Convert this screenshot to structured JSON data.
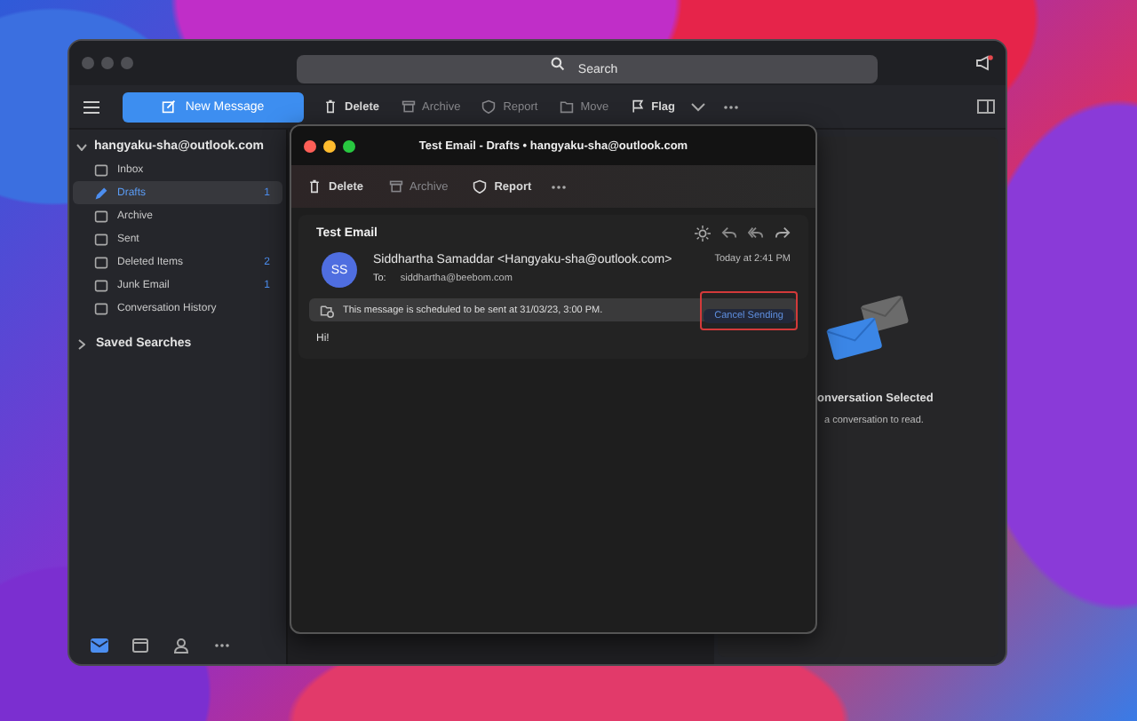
{
  "search": {
    "placeholder": "Search"
  },
  "toolbar": {
    "new_message": "New Message",
    "items": [
      {
        "label": "Delete",
        "disabled": false
      },
      {
        "label": "Archive",
        "disabled": true
      },
      {
        "label": "Report",
        "disabled": true
      },
      {
        "label": "Move",
        "disabled": true
      },
      {
        "label": "Flag",
        "disabled": false
      }
    ]
  },
  "sidebar": {
    "account": "hangyaku-sha@outlook.com",
    "expanded": true,
    "folders": [
      {
        "label": "Inbox",
        "selected": false
      },
      {
        "label": "Drafts",
        "count": "1",
        "selected": true
      },
      {
        "label": "Archive",
        "selected": false
      },
      {
        "label": "Sent",
        "selected": false
      },
      {
        "label": "Deleted Items",
        "count": "2",
        "selected": false
      },
      {
        "label": "Junk Email",
        "count": "1",
        "selected": false
      },
      {
        "label": "Conversation History",
        "selected": false
      }
    ],
    "saved_searches": {
      "label": "Saved Searches",
      "expanded": false
    },
    "nav": [
      {
        "selected": true
      },
      {
        "selected": false
      },
      {
        "selected": false
      },
      {
        "selected": false
      }
    ]
  },
  "reading_pane": {
    "title": "onversation Selected",
    "hint": "a conversation to read."
  },
  "draft_window": {
    "title": "Test Email - Drafts • hangyaku-sha@outlook.com",
    "toolbar": [
      {
        "label": "Delete",
        "disabled": false
      },
      {
        "label": "Archive",
        "disabled": true
      },
      {
        "label": "Report",
        "disabled": false
      }
    ],
    "subject": "Test Email",
    "avatar": "SS",
    "sender": "Siddhartha Samaddar <Hangyaku-sha@outlook.com>",
    "to_label": "To:",
    "to": "siddhartha@beebom.com",
    "time": "Today at 2:41 PM",
    "banner": "This message is scheduled to be sent at 31/03/23, 3:00 PM.",
    "cancel_button": "Cancel Sending",
    "body": "Hi!"
  }
}
